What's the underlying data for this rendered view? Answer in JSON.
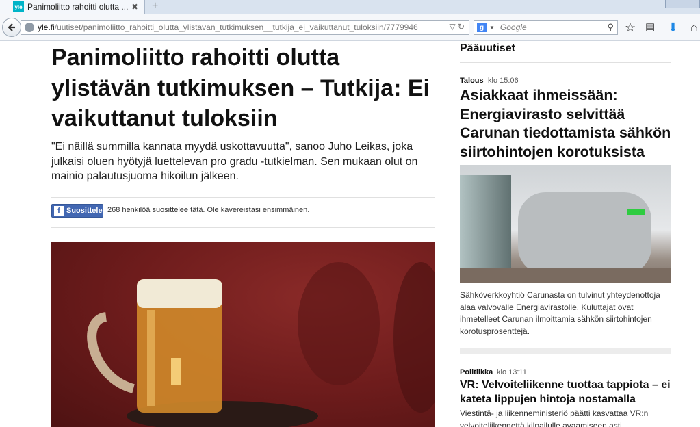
{
  "browser": {
    "tab_title": "Panimoliitto rahoitti olutta ...",
    "tab_close": "✖",
    "new_tab": "+",
    "favicon_text": "yle",
    "url_host": "yle.fi",
    "url_path": "/uutiset/panimoliitto_rahoitti_olutta_ylistavan_tutkimuksen__tutkija_ei_vaikuttanut_tuloksiin/7779946",
    "search_placeholder": "Google",
    "search_engine_letter": "g"
  },
  "article": {
    "headline": "Panimoliitto rahoitti olutta ylistävän tutkimuksen – Tutkija: Ei vaikuttanut tuloksiin",
    "lead": "\"Ei näillä summilla kannata myydä uskottavuutta\", sanoo Juho Leikas, joka julkaisi oluen hyötyjä luettelevan pro gradu -tutkielman. Sen mukaan olut on mainio palautusjuoma hikoilun jälkeen.",
    "like_button": "Suosittele",
    "like_icon": "f",
    "like_text": "268 henkilöä suosittelee tätä. Ole kavereistasi ensimmäinen."
  },
  "sidebar": {
    "title": "Pääuutiset",
    "items": [
      {
        "category": "Talous",
        "time": "klo 15:06",
        "headline": "Asiakkaat ihmeissään: Energiavirasto selvittää Carunan tiedottamista sähkön siirtohintojen korotuksista",
        "summary": "Sähköverkkoyhtiö Carunasta on tulvinut yhteydenottoja alaa valvovalle Energiavirastolle. Kuluttajat ovat ihmetelleet Carunan ilmoittamia sähkön siirtohintojen korotusprosenttejä."
      },
      {
        "category": "Politiikka",
        "time": "klo 13:11",
        "headline": "VR: Velvoiteliikenne tuottaa tappiota – ei kateta lippujen hintoja nostamalla",
        "summary": "Viestintä- ja liikenneministeriö päätti kasvattaa VR:n velvoiteliikennettä kilpailulle avaamiseen asti. Käytännössä"
      }
    ]
  },
  "colors": {
    "facebook": "#4267b2",
    "yle_accent": "#00b4c8"
  }
}
